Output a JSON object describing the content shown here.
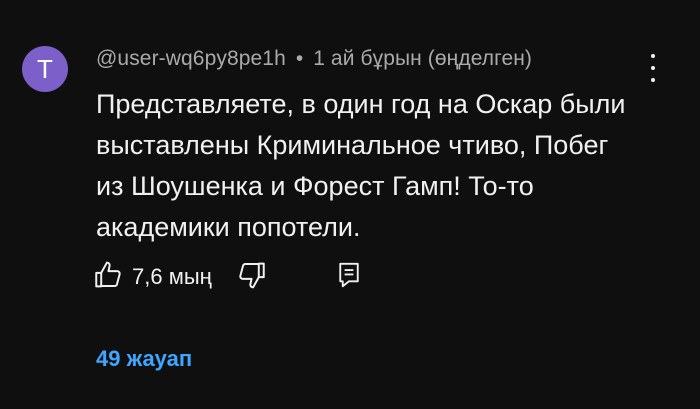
{
  "comment": {
    "avatar_letter": "T",
    "avatar_color": "#7d5fc9",
    "author": "@user-wq6py8pe1h",
    "separator": "•",
    "time": "1 ай бұрын (өңделген)",
    "text_lines": [
      "Представляете, в один год на Оскар были",
      "выставлены Криминальное чтиво, Побег",
      "из Шоушенка и Форест Гамп! То-то",
      "академики попотели."
    ],
    "like_count": "7,6 мың",
    "replies_label": "49 жауап",
    "accent_color": "#3ea6ff"
  },
  "icons": {
    "like": "thumbs-up-icon",
    "dislike": "thumbs-down-icon",
    "reply": "comment-icon",
    "menu": "more-vertical-icon"
  }
}
